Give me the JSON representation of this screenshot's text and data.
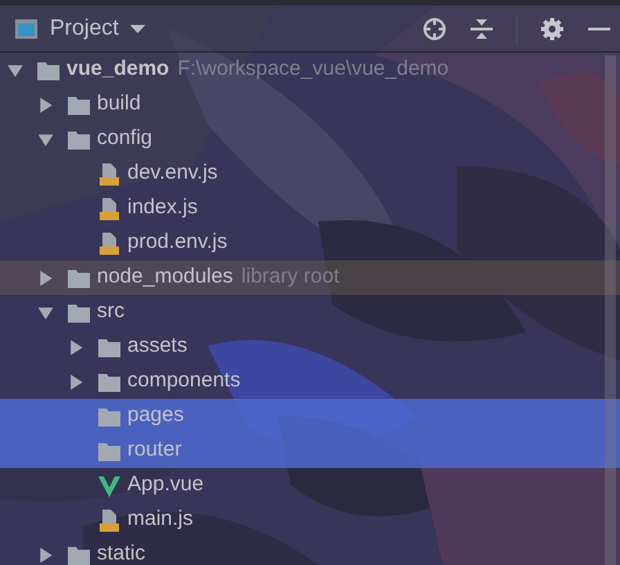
{
  "panel": {
    "title": "Project"
  },
  "tree": [
    {
      "kind": "folder",
      "name": "vue_demo",
      "hint": "F:\\workspace_vue\\vue_demo",
      "expanded": true,
      "selected": false,
      "hovered": false,
      "children": [
        {
          "kind": "folder",
          "name": "build",
          "expanded": false,
          "selected": false,
          "hovered": false
        },
        {
          "kind": "folder",
          "name": "config",
          "expanded": true,
          "selected": false,
          "hovered": false,
          "children": [
            {
              "kind": "js",
              "name": "dev.env.js",
              "selected": false,
              "hovered": false
            },
            {
              "kind": "js",
              "name": "index.js",
              "selected": false,
              "hovered": false
            },
            {
              "kind": "js",
              "name": "prod.env.js",
              "selected": false,
              "hovered": false
            }
          ]
        },
        {
          "kind": "folder",
          "name": "node_modules",
          "hint": "library root",
          "expanded": false,
          "selected": false,
          "hovered": true
        },
        {
          "kind": "folder",
          "name": "src",
          "expanded": true,
          "selected": false,
          "hovered": false,
          "children": [
            {
              "kind": "folder",
              "name": "assets",
              "expanded": false,
              "selected": false,
              "hovered": false
            },
            {
              "kind": "folder",
              "name": "components",
              "expanded": false,
              "selected": false,
              "hovered": false
            },
            {
              "kind": "folder",
              "name": "pages",
              "selected": true,
              "hovered": false
            },
            {
              "kind": "folder",
              "name": "router",
              "selected": true,
              "hovered": false
            },
            {
              "kind": "vue",
              "name": "App.vue",
              "selected": false,
              "hovered": false
            },
            {
              "kind": "js",
              "name": "main.js",
              "selected": false,
              "hovered": false
            }
          ]
        },
        {
          "kind": "folder",
          "name": "static",
          "expanded": false,
          "selected": false,
          "hovered": false
        }
      ]
    }
  ]
}
